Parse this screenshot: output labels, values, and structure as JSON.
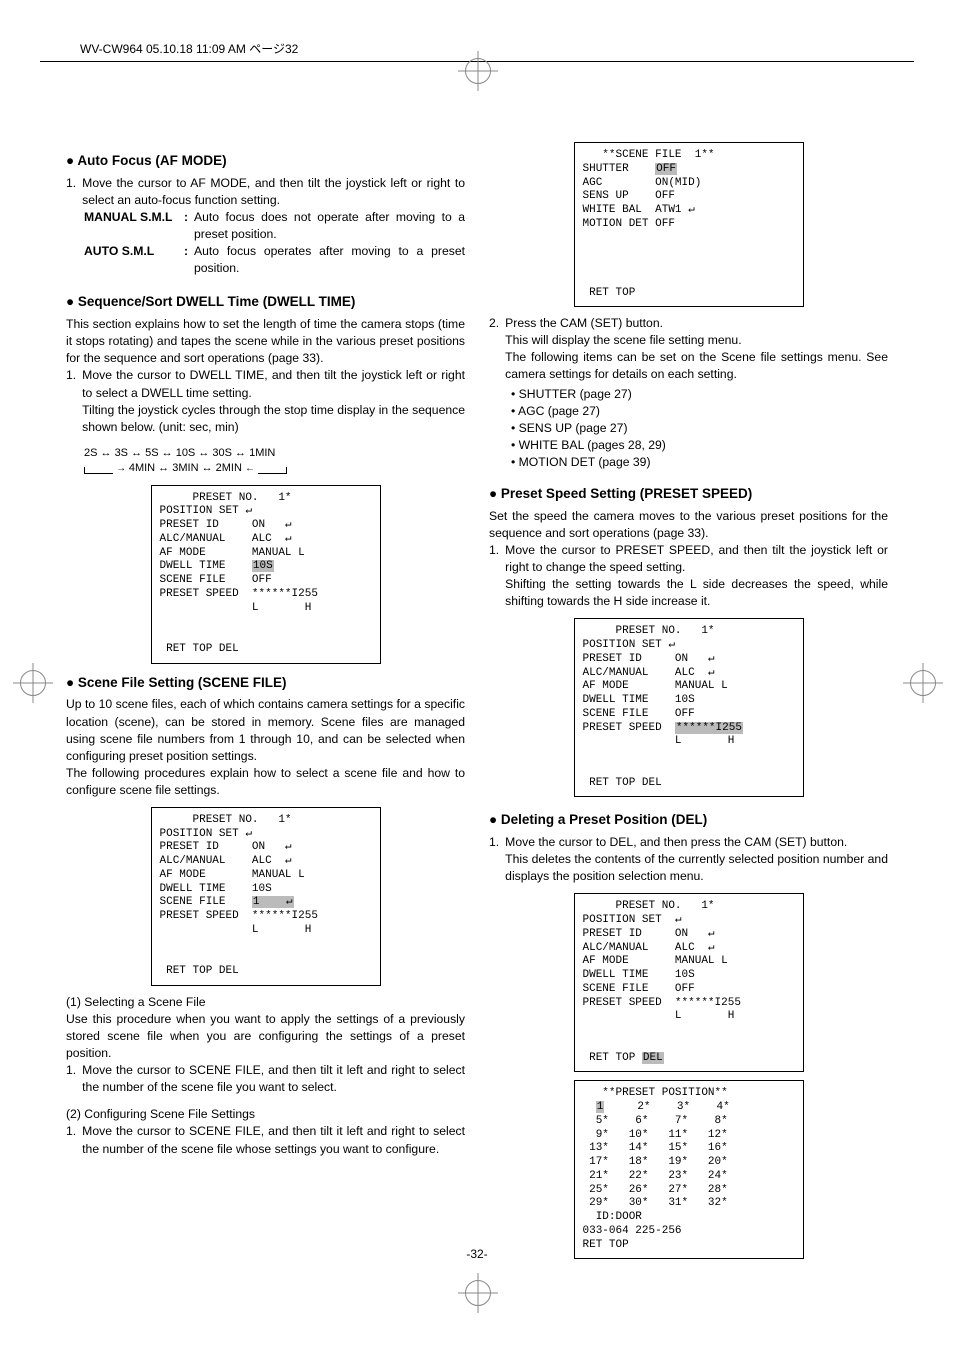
{
  "header": {
    "slug": "WV-CW964  05.10.18  11:09 AM  ページ32"
  },
  "page_number": "-32-",
  "left": {
    "h_af": "Auto Focus (AF MODE)",
    "af1": "Move the cursor to AF MODE, and then tilt the joystick left or right to select an auto-focus function setting.",
    "def1_label": "MANUAL S.M.L",
    "def1_val": "Auto focus does not operate after moving to a preset position.",
    "def2_label": "AUTO S.M.L",
    "def2_val": "Auto focus operates after moving to a preset position.",
    "h_dwell": "Sequence/Sort DWELL Time (DWELL TIME)",
    "dwell_p1": "This section explains how to set the length of time the camera stops (time it stops rotating) and tapes the scene while in the various preset positions for the sequence and sort operations (page 33).",
    "dwell_1a": "Move the cursor to DWELL TIME, and then tilt the joystick left or right to select a DWELL time setting.",
    "dwell_1b": "Tilting the joystick cycles through the stop time display in the sequence shown below. (unit: sec, min)",
    "cycle_top": "2S ↔ 3S ↔ 5S ↔ 10S ↔ 30S ↔ 1MIN",
    "cycle_bot": "4MIN ↔ 3MIN ↔ 2MIN",
    "h_scene": "Scene File Setting (SCENE FILE)",
    "scene_p1": "Up to 10 scene files, each of which contains camera settings for a specific location (scene), can be stored in memory. Scene files are managed using scene file numbers from 1 through 10, and can be selected when configuring preset position settings.",
    "scene_p2": "The following procedures explain how to select a scene file and how to configure scene file settings.",
    "sel_h": "(1) Selecting a Scene File",
    "sel_p": "Use this procedure when you want to apply the settings of a previously stored scene file when you are configuring the settings of a preset position.",
    "sel_1": "Move the cursor to SCENE FILE, and then tilt it left and right to select the number of the scene file you want to select.",
    "cfg_h": "(2) Configuring Scene File Settings",
    "cfg_1": "Move the cursor to SCENE FILE, and then tilt it left and right to select the number of the scene file whose settings you want to configure."
  },
  "right": {
    "step2": "Press the CAM (SET) button.",
    "step2a": "This will display the scene file setting menu.",
    "step2b": "The following items can be set on the Scene file settings menu. See camera settings for details on each setting.",
    "bul1": "SHUTTER (page 27)",
    "bul2": "AGC (page 27)",
    "bul3": "SENS UP (page 27)",
    "bul4": "WHITE BAL (pages 28, 29)",
    "bul5": "MOTION DET (page 39)",
    "h_speed": "Preset Speed Setting (PRESET SPEED)",
    "speed_p": "Set the speed the camera moves to the various preset positions for the sequence and sort operations (page 33).",
    "speed_1a": "Move the cursor to PRESET SPEED, and then tilt the joystick left or right to change the speed setting.",
    "speed_1b": "Shifting the setting towards the L side decreases the speed, while shifting towards the H side increase it.",
    "h_del": "Deleting a Preset Position (DEL)",
    "del_1a": "Move the cursor to DEL, and then press the CAM (SET) button.",
    "del_1b": "This deletes the contents of the currently selected position number and displays the position selection menu."
  },
  "screens": {
    "dwell_box": "     PRESET NO.   1*\nPOSITION SET ↵\nPRESET ID     ON   ↵\nALC/MANUAL    ALC  ↵\nAF MODE       MANUAL L\nDWELL TIME    ",
    "dwell_hl": "10S",
    "dwell_box2": "\nSCENE FILE    OFF\nPRESET SPEED  ******I255\n              L       H\n\n\n RET TOP DEL",
    "scene_box": "     PRESET NO.   1*\nPOSITION SET ↵\nPRESET ID     ON   ↵\nALC/MANUAL    ALC  ↵\nAF MODE       MANUAL L\nDWELL TIME    10S\nSCENE FILE    ",
    "scene_hl": "1    ↵",
    "scene_box2": "\nPRESET SPEED  ******I255\n              L       H\n\n\n RET TOP DEL",
    "sfile_box": "   **SCENE FILE  1**\nSHUTTER    ",
    "sfile_hl": "OFF",
    "sfile_box2": "\nAGC        ON(MID)\nSENS UP    OFF\nWHITE BAL  ATW1 ↵\nMOTION DET OFF\n\n\n\n\n RET TOP",
    "speed_box": "     PRESET NO.   1*\nPOSITION SET ↵\nPRESET ID     ON   ↵\nALC/MANUAL    ALC  ↵\nAF MODE       MANUAL L\nDWELL TIME    10S\nSCENE FILE    OFF\nPRESET SPEED  ",
    "speed_hl": "******I255",
    "speed_box2": "\n              L       H\n\n\n RET TOP DEL",
    "del_box": "     PRESET NO.   1*\nPOSITION SET  ↵\nPRESET ID     ON   ↵\nALC/MANUAL    ALC  ↵\nAF MODE       MANUAL L\nDWELL TIME    10S\nSCENE FILE    OFF\nPRESET SPEED  ******I255\n              L       H\n\n\n RET TOP ",
    "del_hl": "DEL",
    "pp_box": "   **PRESET POSITION**\n  ",
    "pp_hl": "1",
    "pp_box2": "     2*    3*    4*\n  5*    6*    7*    8*\n  9*   10*   11*   12*\n 13*   14*   15*   16*\n 17*   18*   19*   20*\n 21*   22*   23*   24*\n 25*   26*   27*   28*\n 29*   30*   31*   32*\n  ID:DOOR\n033-064 225-256\nRET TOP"
  }
}
